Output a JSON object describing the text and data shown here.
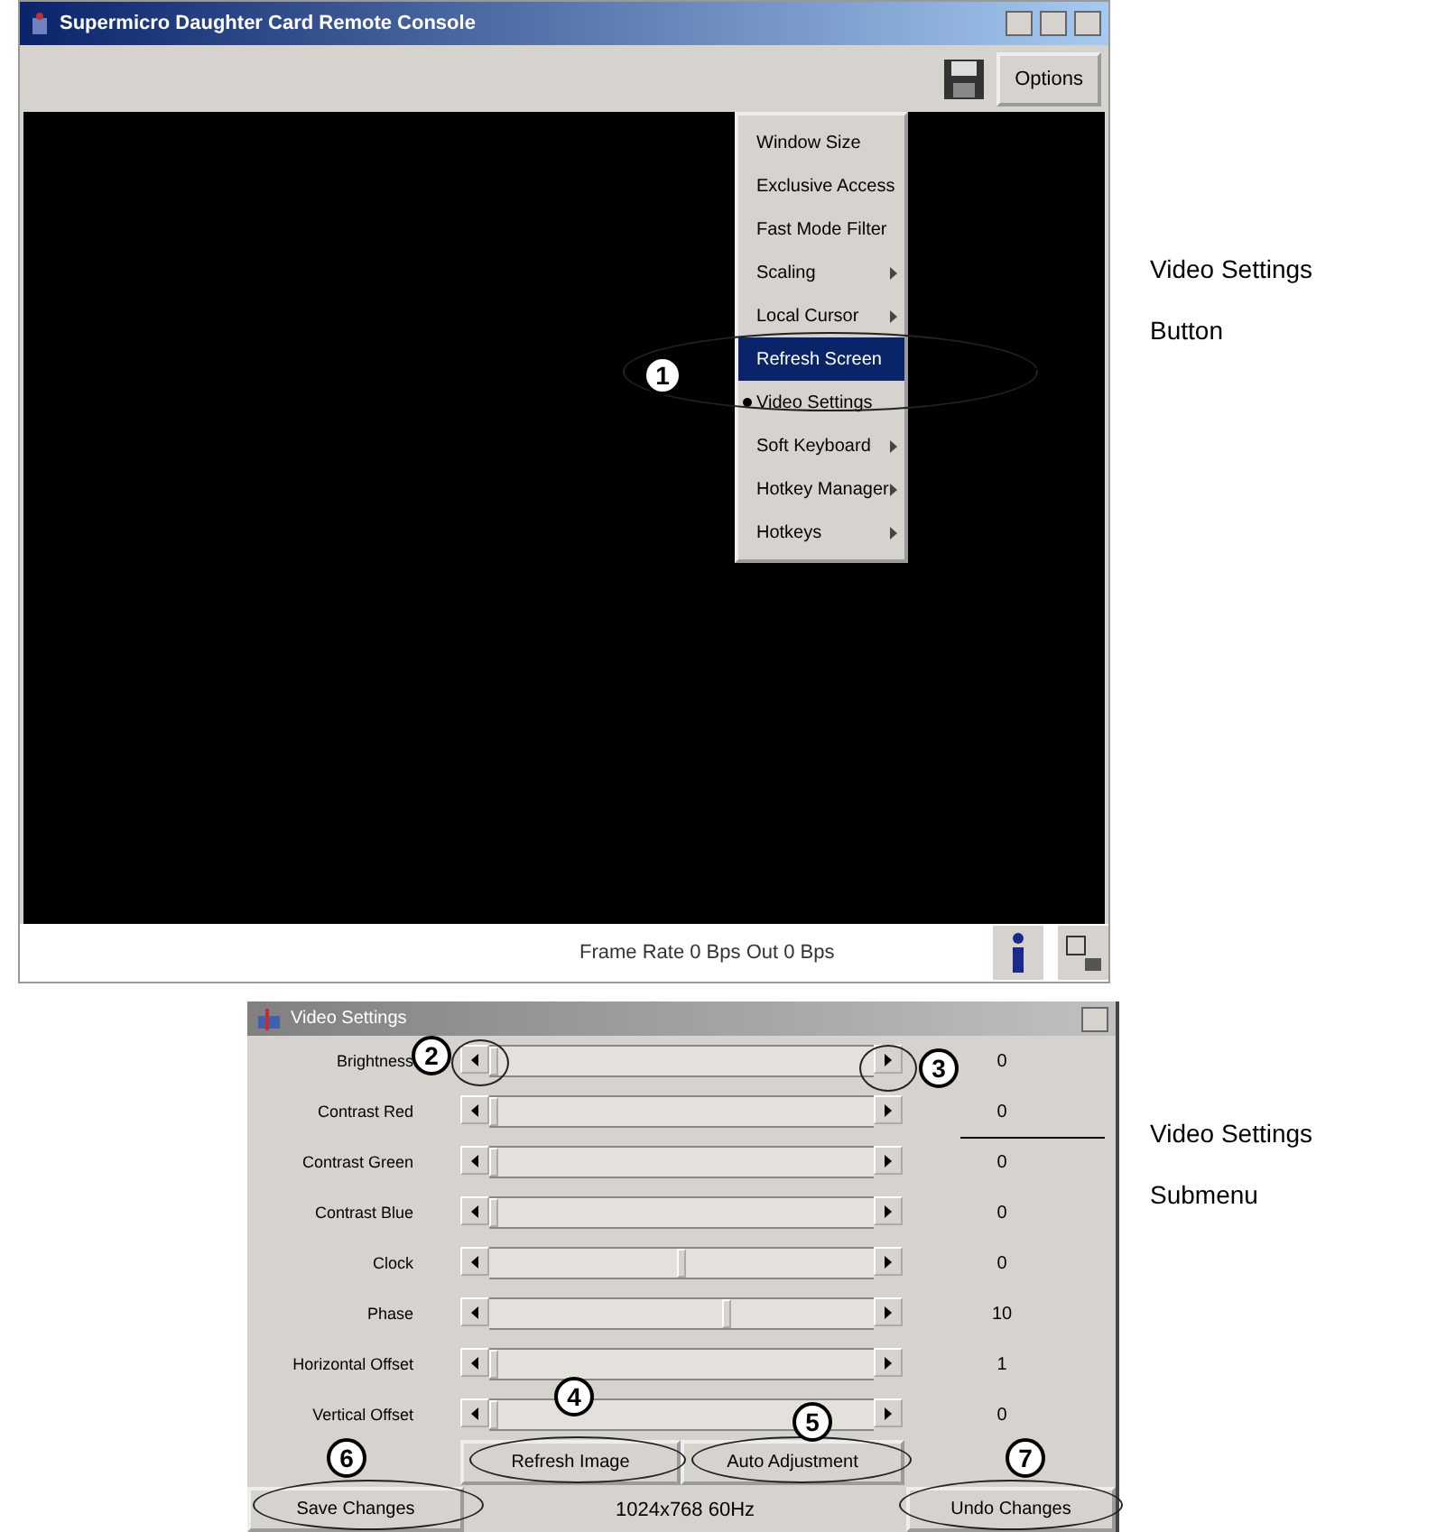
{
  "console_window": {
    "title": "Supermicro Daughter Card Remote Console",
    "toolbar": {
      "options_button": "Options"
    },
    "options_menu": [
      {
        "label": "Window Size",
        "submenu": false,
        "checked": false,
        "selected": false
      },
      {
        "label": "Exclusive Access",
        "submenu": false,
        "checked": false,
        "selected": false
      },
      {
        "label": "Fast Mode Filter",
        "submenu": false,
        "checked": false,
        "selected": false
      },
      {
        "label": "Scaling",
        "submenu": true,
        "checked": false,
        "selected": false
      },
      {
        "label": "Local Cursor",
        "submenu": true,
        "checked": false,
        "selected": false
      },
      {
        "label": "Refresh Screen",
        "submenu": false,
        "checked": false,
        "selected": true
      },
      {
        "label": "Video Settings",
        "submenu": false,
        "checked": true,
        "selected": false
      },
      {
        "label": "Soft Keyboard",
        "submenu": true,
        "checked": false,
        "selected": false
      },
      {
        "label": "Hotkey Manager",
        "submenu": true,
        "checked": false,
        "selected": false
      },
      {
        "label": "Hotkeys",
        "submenu": true,
        "checked": false,
        "selected": false
      }
    ],
    "status_text": "Frame Rate 0 Bps Out 0 Bps"
  },
  "video_settings": {
    "title": "Video Settings",
    "sliders": [
      {
        "label": "Brightness",
        "level": 0.0,
        "reading": "0"
      },
      {
        "label": "Contrast Red",
        "level": 0.0,
        "reading": "0"
      },
      {
        "label": "Contrast Green",
        "level": 0.0,
        "reading": "0"
      },
      {
        "label": "Contrast Blue",
        "level": 0.0,
        "reading": "0"
      },
      {
        "label": "Clock",
        "level": 0.5,
        "reading": "0"
      },
      {
        "label": "Phase",
        "level": 0.62,
        "reading": "10"
      },
      {
        "label": "Horizontal Offset",
        "level": 0.0,
        "reading": "1"
      },
      {
        "label": "Vertical Offset",
        "level": 0.0,
        "reading": "0"
      }
    ],
    "action_buttons": [
      "Refresh Image",
      "Auto Adjustment"
    ],
    "save_button": "Save Changes",
    "resolution": "1024x768 60Hz",
    "undo_button": "Undo Changes"
  },
  "annotations": {
    "markers": [
      "1",
      "2",
      "3",
      "4",
      "5",
      "6",
      "7"
    ],
    "callouts": [
      {
        "lines": [
          "Video Settings",
          "Button"
        ]
      },
      {
        "lines": [
          "Video Settings",
          "Submenu"
        ]
      }
    ]
  }
}
